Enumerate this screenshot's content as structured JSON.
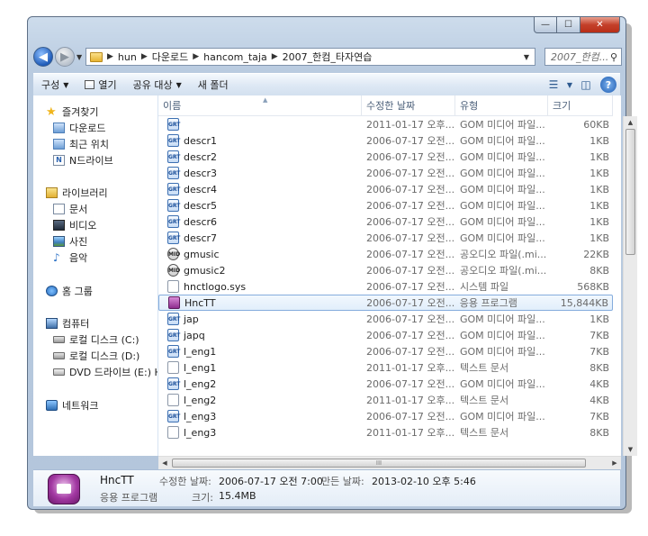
{
  "window": {
    "minimize_glyph": "—",
    "maximize_glyph": "☐",
    "close_glyph": "✕"
  },
  "address": {
    "crumbs": [
      "hun",
      "다운로드",
      "hancom_taja",
      "2007_한컴_타자연습"
    ],
    "search_placeholder": "2007_한컴..."
  },
  "toolbar": {
    "organize": "구성",
    "open": "열기",
    "share": "공유 대상",
    "new_folder": "새 폴더"
  },
  "nav": {
    "favorites": "즐겨찾기",
    "downloads": "다운로드",
    "recent": "최근 위치",
    "ndrive": "N드라이브",
    "libraries": "라이브러리",
    "documents": "문서",
    "videos": "비디오",
    "pictures": "사진",
    "music": "음악",
    "homegroup": "홈 그룹",
    "computer": "컴퓨터",
    "disk_c": "로컬 디스크 (C:)",
    "disk_d": "로컬 디스크 (D:)",
    "dvd": "DVD 드라이브 (E:) H",
    "network": "네트워크"
  },
  "columns": {
    "name": "이름",
    "modified": "수정한 날짜",
    "type": "유형",
    "size": "크기"
  },
  "files": [
    {
      "name": "",
      "date": "2011-01-17 오후...",
      "type": "GOM 미디어 파일...",
      "size": "60KB",
      "icon": "gom"
    },
    {
      "name": "descr1",
      "date": "2006-07-17 오전...",
      "type": "GOM 미디어 파일...",
      "size": "1KB",
      "icon": "gom"
    },
    {
      "name": "descr2",
      "date": "2006-07-17 오전...",
      "type": "GOM 미디어 파일...",
      "size": "1KB",
      "icon": "gom"
    },
    {
      "name": "descr3",
      "date": "2006-07-17 오전...",
      "type": "GOM 미디어 파일...",
      "size": "1KB",
      "icon": "gom"
    },
    {
      "name": "descr4",
      "date": "2006-07-17 오전...",
      "type": "GOM 미디어 파일...",
      "size": "1KB",
      "icon": "gom"
    },
    {
      "name": "descr5",
      "date": "2006-07-17 오전...",
      "type": "GOM 미디어 파일...",
      "size": "1KB",
      "icon": "gom"
    },
    {
      "name": "descr6",
      "date": "2006-07-17 오전...",
      "type": "GOM 미디어 파일...",
      "size": "1KB",
      "icon": "gom"
    },
    {
      "name": "descr7",
      "date": "2006-07-17 오전...",
      "type": "GOM 미디어 파일...",
      "size": "1KB",
      "icon": "gom"
    },
    {
      "name": "gmusic",
      "date": "2006-07-17 오전...",
      "type": "공오디오 파일(.mi...",
      "size": "22KB",
      "icon": "midi"
    },
    {
      "name": "gmusic2",
      "date": "2006-07-17 오전...",
      "type": "공오디오 파일(.mi...",
      "size": "8KB",
      "icon": "midi"
    },
    {
      "name": "hnctlogo.sys",
      "date": "2006-07-17 오전...",
      "type": "시스템 파일",
      "size": "568KB",
      "icon": "sys"
    },
    {
      "name": "HncTT",
      "date": "2006-07-17 오전...",
      "type": "응용 프로그램",
      "size": "15,844KB",
      "icon": "exe",
      "selected": true
    },
    {
      "name": "jap",
      "date": "2006-07-17 오전...",
      "type": "GOM 미디어 파일...",
      "size": "1KB",
      "icon": "gom"
    },
    {
      "name": "japq",
      "date": "2006-07-17 오전...",
      "type": "GOM 미디어 파일...",
      "size": "7KB",
      "icon": "gom"
    },
    {
      "name": "l_eng1",
      "date": "2006-07-17 오전...",
      "type": "GOM 미디어 파일...",
      "size": "7KB",
      "icon": "gom"
    },
    {
      "name": "l_eng1",
      "date": "2011-01-17 오후...",
      "type": "텍스트 문서",
      "size": "8KB",
      "icon": "txt"
    },
    {
      "name": "l_eng2",
      "date": "2006-07-17 오전...",
      "type": "GOM 미디어 파일...",
      "size": "4KB",
      "icon": "gom"
    },
    {
      "name": "l_eng2",
      "date": "2011-01-17 오후...",
      "type": "텍스트 문서",
      "size": "4KB",
      "icon": "txt"
    },
    {
      "name": "l_eng3",
      "date": "2006-07-17 오전...",
      "type": "GOM 미디어 파일...",
      "size": "7KB",
      "icon": "gom"
    },
    {
      "name": "l_eng3",
      "date": "2011-01-17 오후...",
      "type": "텍스트 문서",
      "size": "8KB",
      "icon": "txt"
    }
  ],
  "icon_glyphs": {
    "gom": "GRT",
    "midi": "MID",
    "sys": "",
    "exe": "",
    "txt": ""
  },
  "details": {
    "name": "HncTT",
    "type": "응용 프로그램",
    "modified_label": "수정한 날짜:",
    "modified_value": "2006-07-17 오전 7:00",
    "created_label": "만든 날짜:",
    "created_value": "2013-02-10 오후 5:46",
    "size_label": "크기:",
    "size_value": "15.4MB"
  },
  "scroll": {
    "h_grip": "III"
  }
}
